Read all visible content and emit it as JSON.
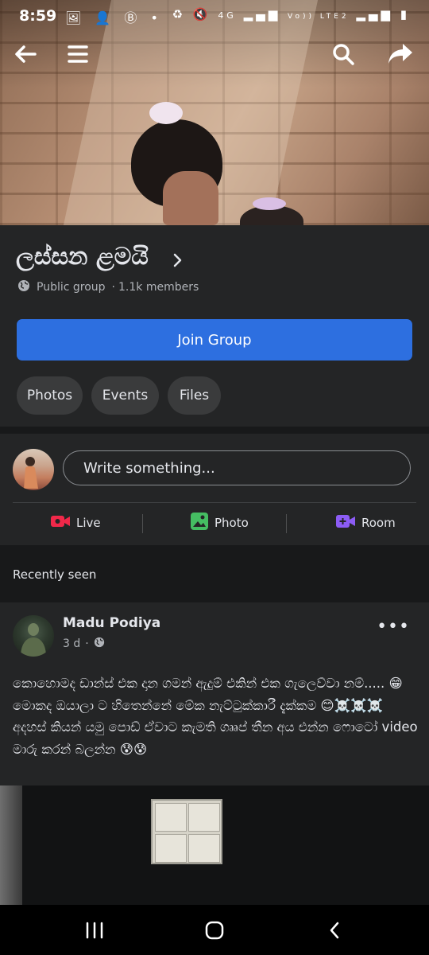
{
  "status_bar": {
    "time": "8:59",
    "left_icons": [
      "image-icon",
      "person-add-icon",
      "b-circle-icon",
      "dot-icon"
    ],
    "right_icons": [
      "recycle-icon",
      "mute-icon",
      "4g-icon",
      "signal-icon",
      "volte-icon",
      "signal-icon",
      "battery-icon"
    ],
    "network_label": "4G",
    "volte_label": "Vo)) LTE2"
  },
  "top_nav": {
    "icons": [
      "back-arrow-icon",
      "menu-icon",
      "search-icon",
      "share-icon"
    ]
  },
  "group": {
    "name": "ලස්සන ළමයි",
    "privacy": "Public group",
    "separator": "·",
    "members": "1.1k members",
    "join_label": "Join Group",
    "tabs": [
      {
        "label": "Photos"
      },
      {
        "label": "Events"
      },
      {
        "label": "Files"
      }
    ]
  },
  "composer": {
    "placeholder": "Write something...",
    "actions": [
      {
        "label": "Live",
        "icon": "live-video-icon",
        "color": "#f02849"
      },
      {
        "label": "Photo",
        "icon": "photo-icon",
        "color": "#45bd62"
      },
      {
        "label": "Room",
        "icon": "room-icon",
        "color": "#8c5cf5"
      }
    ]
  },
  "recently_seen": "Recently seen",
  "post": {
    "author": "Madu Podiya",
    "time": "3 d",
    "separator": "·",
    "audience_icon": "globe-icon",
    "text": "කොහොමද ඩාන්ස් එක දාන ගමන් ඇදුම් එකින් එක ගැලෙව්වා නම්..... 😁 මොකද ඔයාලා ට හිතෙන්නේ මේක නැට්ටුක්කාරී දැක්කම 😊☠️☠️☠️ අදහස් කියන් යමු පොඩ් ඒවාට කැමති ගෲප් තීන අය එන්න ෆොටෝ video මාරු කරන් බලන්න 😰😰"
  },
  "nav_bar": {
    "icons": [
      "recent-apps-icon",
      "home-icon",
      "back-icon"
    ]
  },
  "colors": {
    "background": "#18191a",
    "surface": "#242526",
    "accent": "#2d6fe0",
    "text": "#e4e6eb",
    "secondary_text": "#b0b3b8"
  }
}
